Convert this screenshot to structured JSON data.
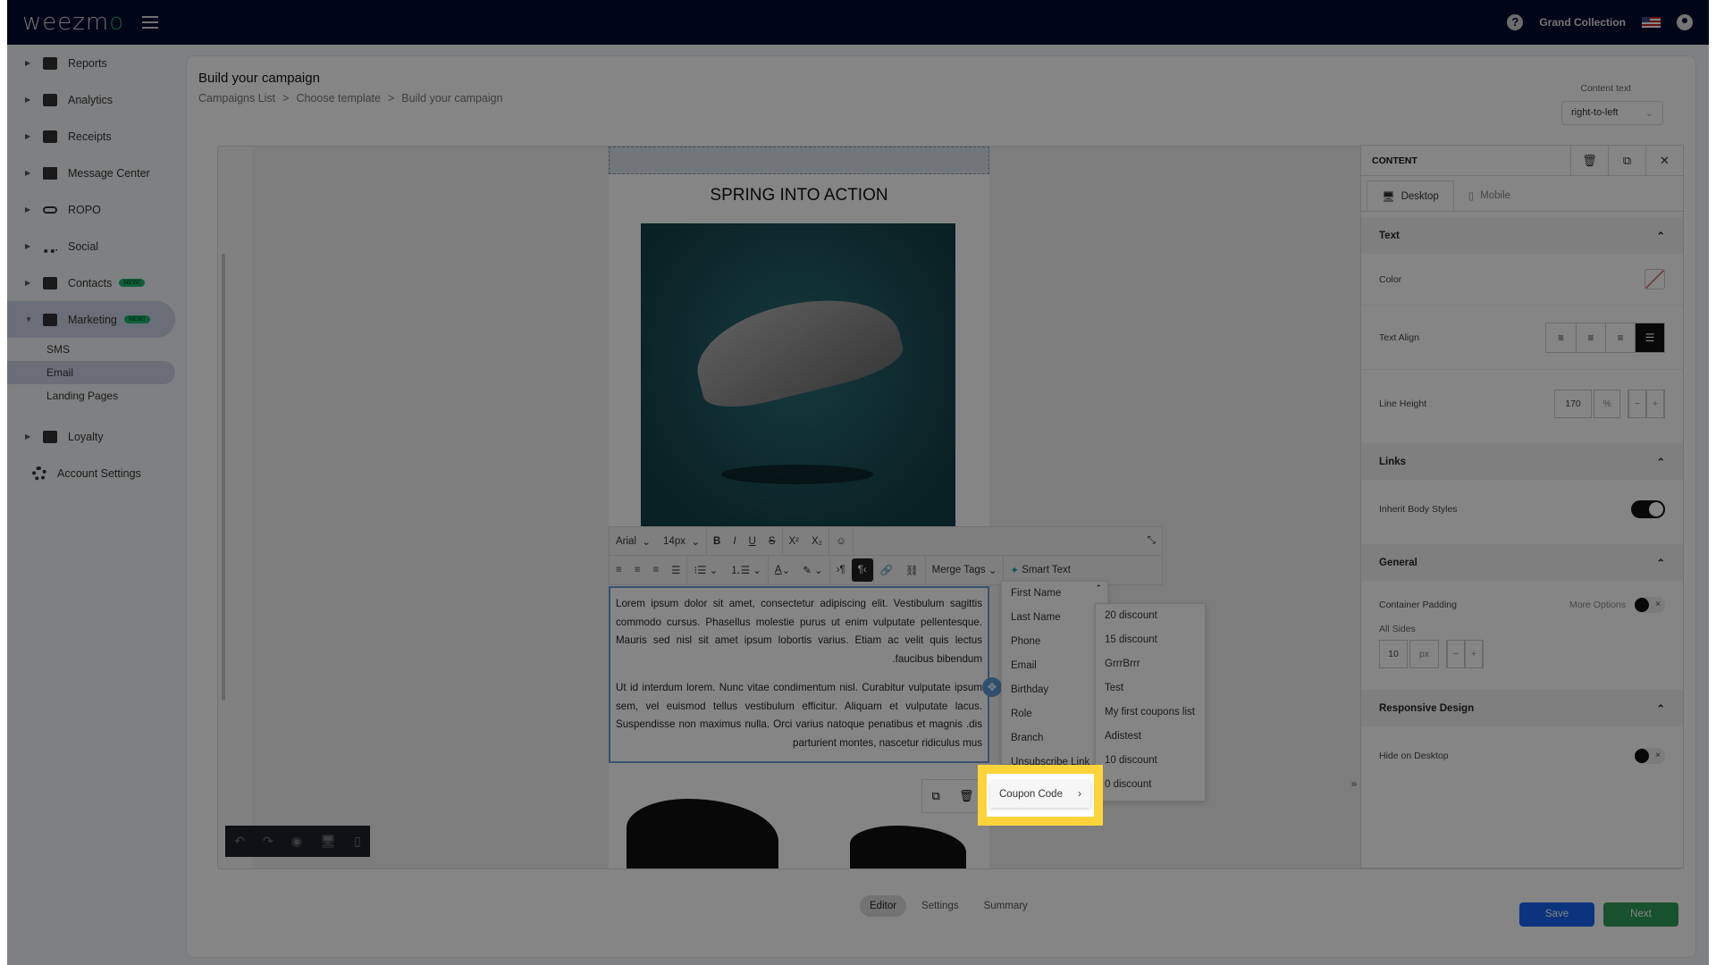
{
  "topbar": {
    "logo_text": "weezmo",
    "brand_name": "Grand Collection",
    "help_icon": "?",
    "locale_flag": "us-flag"
  },
  "sidebar": {
    "items": [
      {
        "label": "Reports",
        "icon": "dashboard-icon"
      },
      {
        "label": "Analytics",
        "icon": "chart-icon"
      },
      {
        "label": "Receipts",
        "icon": "receipt-icon"
      },
      {
        "label": "Message Center",
        "icon": "message-icon"
      },
      {
        "label": "ROPO",
        "icon": "infinity-icon"
      },
      {
        "label": "Social",
        "icon": "people-icon"
      },
      {
        "label": "Contacts",
        "icon": "contacts-icon",
        "badge": "NEW!"
      },
      {
        "label": "Marketing",
        "icon": "party-popper-icon",
        "badge": "NEW!",
        "expanded": true
      },
      {
        "label": "Loyalty",
        "icon": "tag-icon"
      }
    ],
    "marketing_sub": [
      {
        "label": "SMS"
      },
      {
        "label": "Email",
        "selected": true
      },
      {
        "label": "Landing Pages"
      }
    ],
    "account_settings": "Account Settings"
  },
  "page": {
    "title": "Build your campaign",
    "breadcrumb": [
      "Campaigns List",
      "Choose template",
      "Build your campaign"
    ],
    "breadcrumb_sep": ">",
    "content_text_label": "Content text",
    "content_text_value": "right-to-left"
  },
  "email": {
    "heading": "SPRING INTO ACTION",
    "paragraph1": "Lorem ipsum dolor sit amet, consectetur adipiscing elit. Vestibulum sagittis commodo cursus. Phasellus molestie purus ut enim vulputate pellentesque. Mauris sed nisl sit amet ipsum lobortis varius. Etiam ac velit quis lectus .faucibus bibendum",
    "paragraph2": "Ut id interdum lorem. Nunc vitae condimentum nisl. Curabitur vulputate ipsum sem, vel euismod tellus vestibulum efficitur. Aliquam et vulputate lacus. Suspendisse non maximus nulla. Orci varius natoque penatibus et magnis .dis parturient montes, nascetur ridiculus mus"
  },
  "toolbar": {
    "font": "Arial",
    "size": "14px",
    "merge_tags": "Merge Tags",
    "smart_text": "Smart Text"
  },
  "merge_menu": {
    "items": [
      "First Name",
      "Last Name",
      "Phone",
      "Email",
      "Birthday",
      "Role",
      "Branch",
      "Unsubscribe Link"
    ],
    "highlighted": "Coupon Code"
  },
  "coupon_list": {
    "items": [
      "20 discount",
      "15 discount",
      "GrrrBrrr",
      "Test",
      "My first coupons list",
      "Adistest",
      "10 discount",
      "0 discount"
    ]
  },
  "panel": {
    "title": "CONTENT",
    "tabs": [
      {
        "label": "Desktop",
        "active": true
      },
      {
        "label": "Mobile",
        "active": false
      }
    ],
    "sections": {
      "text": "Text",
      "color_label": "Color",
      "text_align_label": "Text Align",
      "text_align_value": "justify",
      "line_height_label": "Line Height",
      "line_height_value": "170",
      "line_height_unit": "%",
      "links": "Links",
      "inherit_label": "Inherit Body Styles",
      "inherit_value": true,
      "general": "General",
      "padding_label": "Container Padding",
      "more_options": "More Options",
      "more_options_value": false,
      "all_sides": "All Sides",
      "padding_value": "10",
      "padding_unit": "px",
      "responsive": "Responsive Design",
      "hide_desktop_label": "Hide on Desktop",
      "hide_desktop_value": false
    }
  },
  "bottom_tabs": [
    {
      "label": "Editor",
      "active": true
    },
    {
      "label": "Settings"
    },
    {
      "label": "Summary"
    }
  ],
  "actions": {
    "save": "Save",
    "next": "Next"
  },
  "colors": {
    "topbar": "#000a2e",
    "save": "#1763f0",
    "next": "#2e9c58",
    "highlight": "#ffd43b",
    "badge": "#1bb76e"
  }
}
